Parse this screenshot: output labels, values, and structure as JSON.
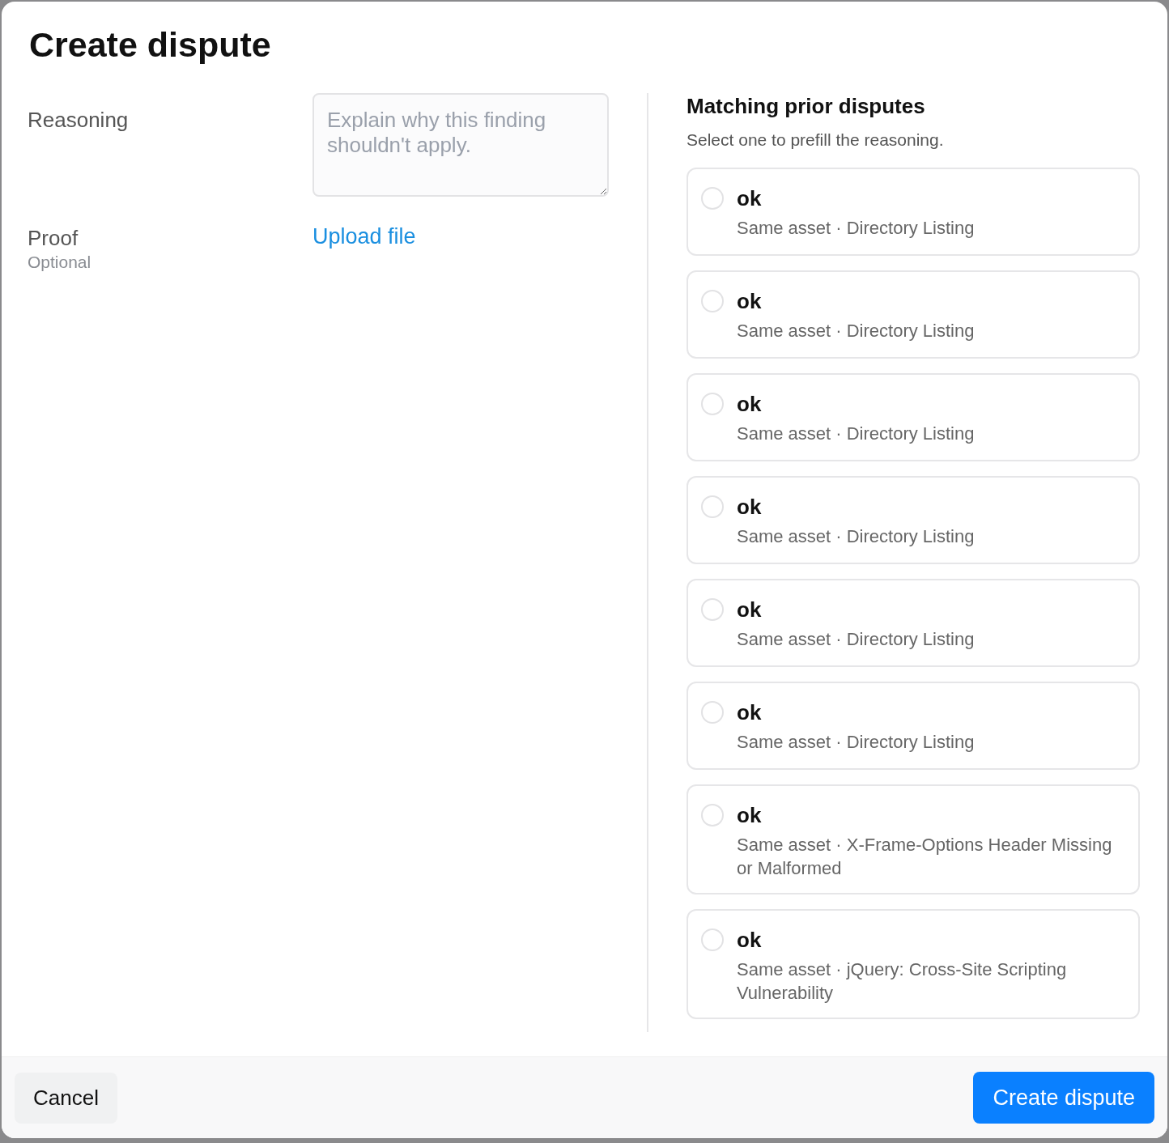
{
  "dialog": {
    "title": "Create dispute"
  },
  "form": {
    "reasoning": {
      "label": "Reasoning",
      "placeholder": "Explain why this finding shouldn't apply."
    },
    "proof": {
      "label": "Proof",
      "hint": "Optional",
      "link": "Upload file"
    }
  },
  "matches": {
    "title": "Matching prior disputes",
    "subtitle": "Select one to prefill the reasoning.",
    "items": [
      {
        "title": "ok",
        "detail": "Same asset · Directory Listing",
        "selected": false
      },
      {
        "title": "ok",
        "detail": "Same asset · Directory Listing",
        "selected": false
      },
      {
        "title": "ok",
        "detail": "Same asset · Directory Listing",
        "selected": false
      },
      {
        "title": "ok",
        "detail": "Same asset · Directory Listing",
        "selected": false
      },
      {
        "title": "ok",
        "detail": "Same asset · Directory Listing",
        "selected": false
      },
      {
        "title": "ok",
        "detail": "Same asset · Directory Listing",
        "selected": false
      },
      {
        "title": "ok",
        "detail": "Same asset · X-Frame-Options Header Missing or Malformed",
        "selected": false
      },
      {
        "title": "ok",
        "detail": "Same asset · jQuery: Cross-Site Scripting Vulnerability",
        "selected": false
      }
    ]
  },
  "footer": {
    "cancel": "Cancel",
    "submit": "Create dispute"
  }
}
